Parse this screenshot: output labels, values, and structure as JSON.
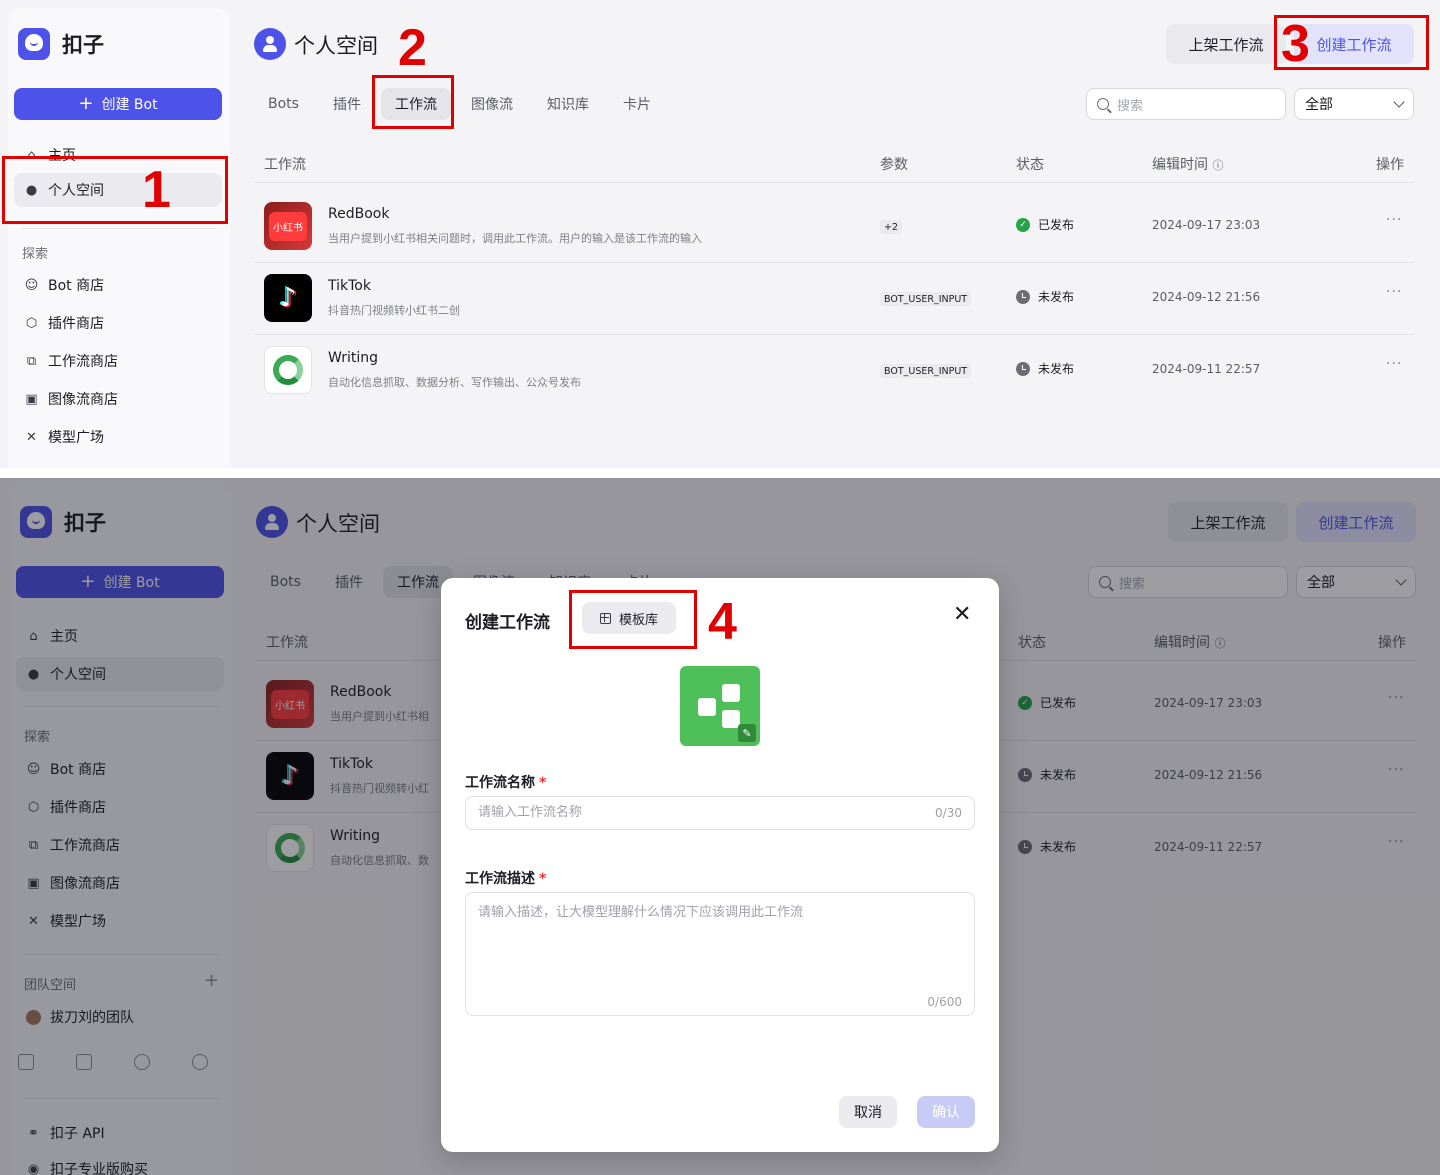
{
  "app": {
    "logo_text": "扣子",
    "create_bot_label": "创建 Bot"
  },
  "nav": {
    "home": "主页",
    "personal": "个人空间",
    "explore_label": "探索",
    "bot_store": "Bot 商店",
    "plugin_store": "插件商店",
    "workflow_store": "工作流商店",
    "image_flow_store": "图像流商店",
    "model_square": "模型广场",
    "team_label": "团队空间",
    "team_name": "拔刀刘的团队",
    "api": "扣子 API",
    "pro": "扣子专业版购买"
  },
  "header": {
    "title": "个人空间",
    "publish_workflow": "上架工作流",
    "create_workflow": "创建工作流"
  },
  "tabs": [
    "Bots",
    "插件",
    "工作流",
    "图像流",
    "知识库",
    "卡片"
  ],
  "search": {
    "placeholder": "搜索"
  },
  "filter": {
    "value": "全部"
  },
  "table": {
    "headers": {
      "workflow": "工作流",
      "params": "参数",
      "status": "状态",
      "edited": "编辑时间",
      "actions": "操作"
    },
    "rows": [
      {
        "name": "RedBook",
        "desc": "当用户提到小红书相关问题时，调用此工作流。用户的输入是该工作流的输入",
        "param": "+2",
        "status": "已发布",
        "time": "2024-09-17 23:03",
        "icon_label": "小红书"
      },
      {
        "name": "TikTok",
        "desc": "抖音热门视频转小红书二创",
        "param": "BOT_USER_INPUT",
        "status": "未发布",
        "time": "2024-09-12 21:56"
      },
      {
        "name": "Writing",
        "desc": "自动化信息抓取、数据分析、写作输出、公众号发布",
        "param": "BOT_USER_INPUT",
        "status": "未发布",
        "time": "2024-09-11 22:57"
      }
    ]
  },
  "bottom_rows_desc": [
    "当用户提到小红书相",
    "抖音热门视频转小红",
    "自动化信息抓取、数"
  ],
  "annotations": [
    "1",
    "2",
    "3",
    "4"
  ],
  "modal": {
    "title": "创建工作流",
    "template_label": "模板库",
    "name_label": "工作流名称",
    "name_placeholder": "请输入工作流名称",
    "name_counter": "0/30",
    "desc_label": "工作流描述",
    "desc_placeholder": "请输入描述，让大模型理解什么情况下应该调用此工作流",
    "desc_counter": "0/600",
    "cancel": "取消",
    "confirm": "确认",
    "required_mark": "*"
  },
  "colors": {
    "accent": "#4d53e8",
    "annotation": "#e00000",
    "success": "#22a447"
  }
}
